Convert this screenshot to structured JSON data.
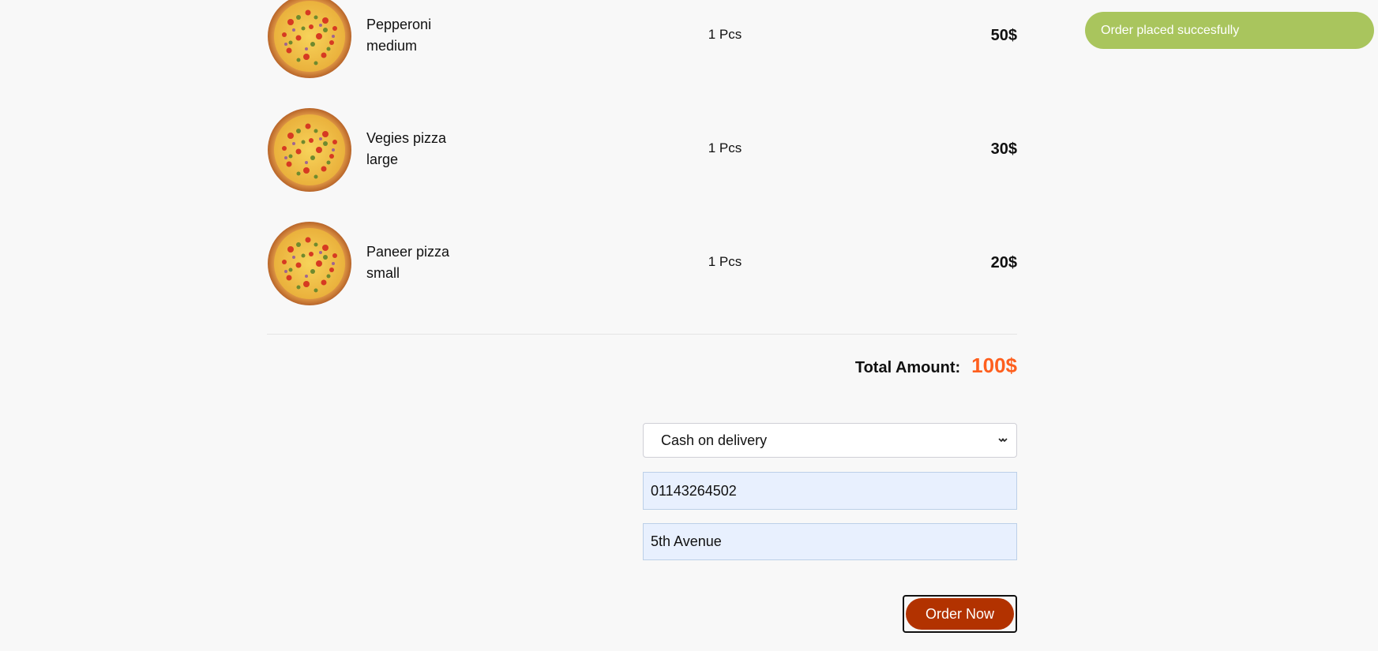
{
  "toast": {
    "message": "Order placed succesfully",
    "color": "#a9c55d"
  },
  "cart": {
    "items": [
      {
        "name": "Pepperoni",
        "size": "medium",
        "qty": "1 Pcs",
        "price": "50$",
        "icon": "pizza-image"
      },
      {
        "name": "Vegies pizza",
        "size": "large",
        "qty": "1 Pcs",
        "price": "30$",
        "icon": "pizza-image"
      },
      {
        "name": "Paneer pizza",
        "size": "small",
        "qty": "1 Pcs",
        "price": "20$",
        "icon": "pizza-image"
      }
    ],
    "total_label": "Total Amount:",
    "total_value": "100$",
    "accent_color": "#fe5f1e"
  },
  "form": {
    "payment_selected": "Cash on delivery",
    "phone_value": "01143264502",
    "address_value": "5th Avenue",
    "submit_label": "Order Now",
    "submit_color": "#b23200"
  }
}
